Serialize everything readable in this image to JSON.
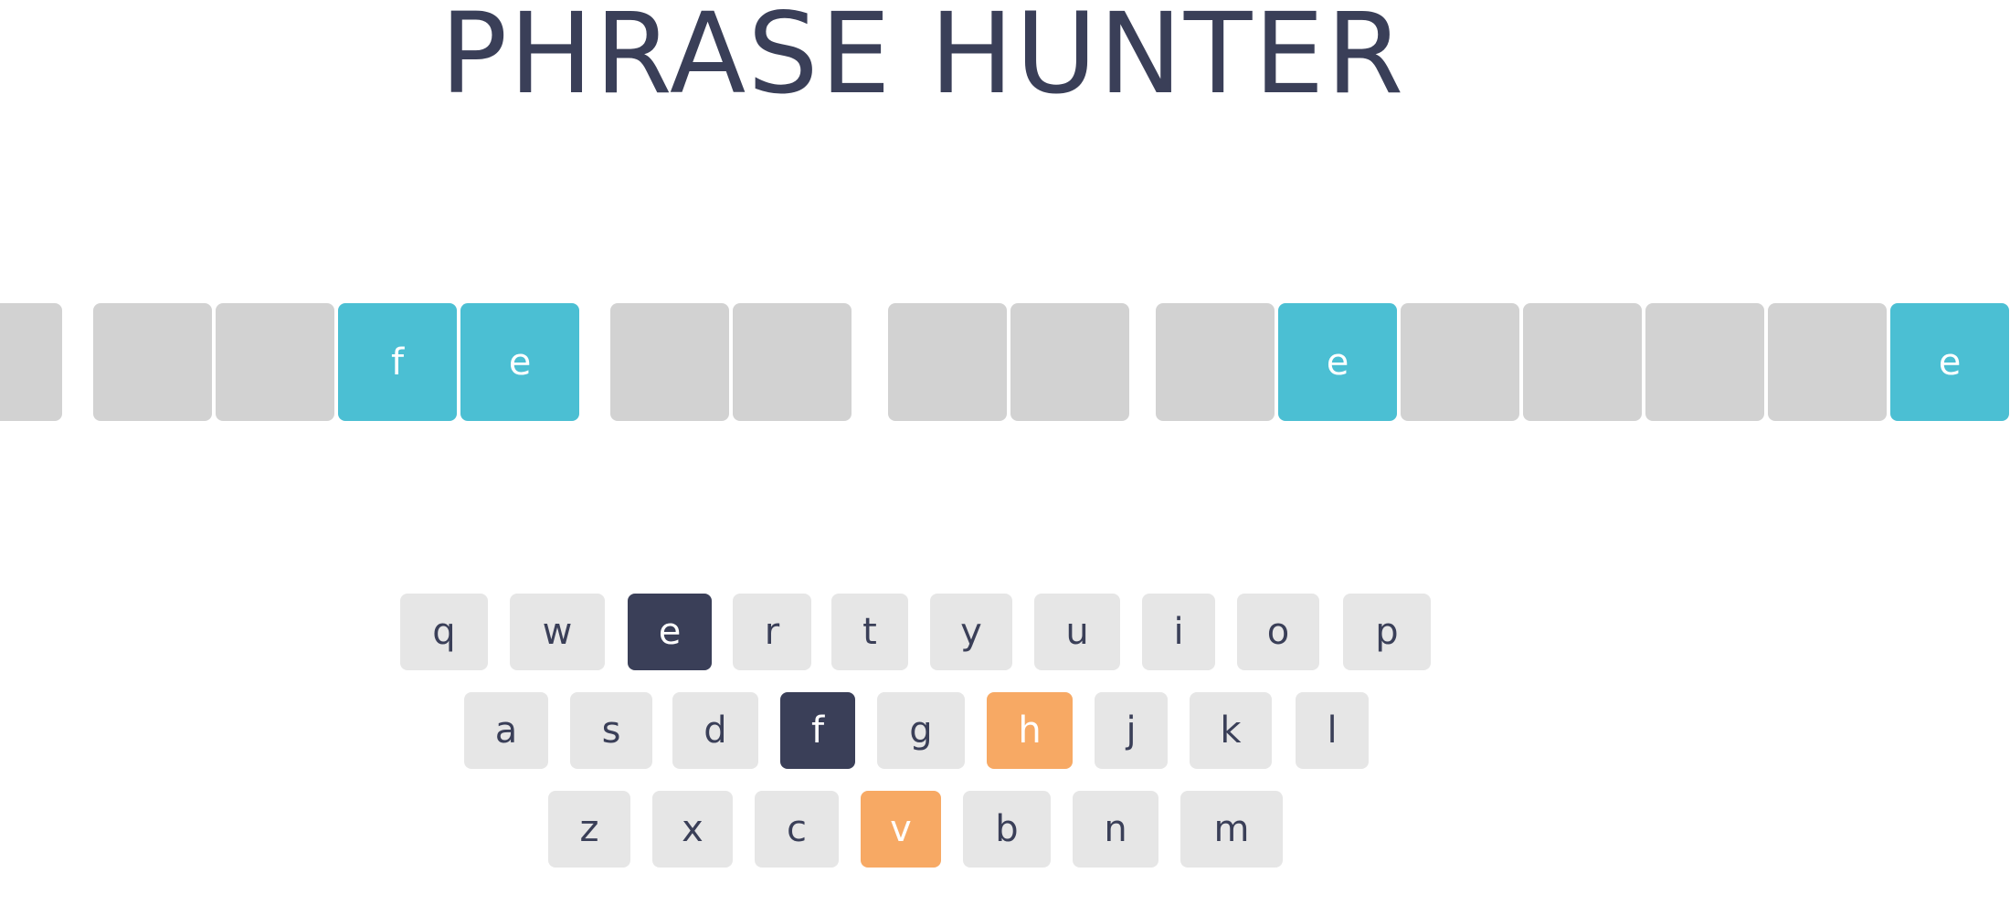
{
  "header": {
    "title": "PHRASE HUNTER"
  },
  "phrase": {
    "letters": [
      {
        "char": "",
        "state": "hide"
      },
      {
        "char": "",
        "state": "hide"
      },
      {
        "char": "",
        "state": "hide"
      },
      {
        "char": "f",
        "state": "show"
      },
      {
        "char": "e",
        "state": "show"
      },
      {
        "char": "",
        "state": "hide"
      },
      {
        "char": "",
        "state": "hide"
      },
      {
        "char": "",
        "state": "hide"
      },
      {
        "char": "",
        "state": "hide"
      },
      {
        "char": "",
        "state": "hide"
      },
      {
        "char": "e",
        "state": "show"
      },
      {
        "char": "",
        "state": "hide"
      },
      {
        "char": "",
        "state": "hide"
      },
      {
        "char": "",
        "state": "hide"
      },
      {
        "char": "",
        "state": "hide"
      },
      {
        "char": "e",
        "state": "show"
      }
    ]
  },
  "keyboard": {
    "rows": [
      [
        {
          "letter": "q",
          "state": "default"
        },
        {
          "letter": "w",
          "state": "default"
        },
        {
          "letter": "e",
          "state": "chosen"
        },
        {
          "letter": "r",
          "state": "default"
        },
        {
          "letter": "t",
          "state": "default"
        },
        {
          "letter": "y",
          "state": "default"
        },
        {
          "letter": "u",
          "state": "default"
        },
        {
          "letter": "i",
          "state": "default"
        },
        {
          "letter": "o",
          "state": "default"
        },
        {
          "letter": "p",
          "state": "default"
        }
      ],
      [
        {
          "letter": "a",
          "state": "default"
        },
        {
          "letter": "s",
          "state": "default"
        },
        {
          "letter": "d",
          "state": "default"
        },
        {
          "letter": "f",
          "state": "chosen"
        },
        {
          "letter": "g",
          "state": "default"
        },
        {
          "letter": "h",
          "state": "wrong"
        },
        {
          "letter": "j",
          "state": "default"
        },
        {
          "letter": "k",
          "state": "default"
        },
        {
          "letter": "l",
          "state": "default"
        }
      ],
      [
        {
          "letter": "z",
          "state": "default"
        },
        {
          "letter": "x",
          "state": "default"
        },
        {
          "letter": "c",
          "state": "default"
        },
        {
          "letter": "v",
          "state": "wrong"
        },
        {
          "letter": "b",
          "state": "default"
        },
        {
          "letter": "n",
          "state": "default"
        },
        {
          "letter": "m",
          "state": "default"
        }
      ]
    ]
  },
  "colors": {
    "title": "#3a3f58",
    "tile_hidden": "#d2d2d2",
    "tile_shown": "#4bbfd3",
    "key_default": "#e6e6e6",
    "key_chosen": "#3a3f58",
    "key_wrong": "#f7a964"
  }
}
